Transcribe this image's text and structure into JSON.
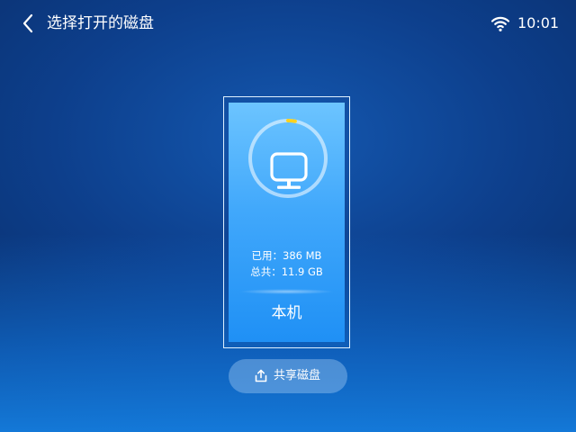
{
  "header": {
    "title": "选择打开的磁盘",
    "back_icon": "chevron-left-icon"
  },
  "status_bar": {
    "wifi_icon": "wifi-icon",
    "time": "10:01"
  },
  "disk": {
    "label": "本机",
    "used_line": "已用：386 MB",
    "total_line": "总共：11.9 GB",
    "usage_fraction": 0.03,
    "icon": "monitor-icon",
    "ring_accent_color": "#ffd21f",
    "selected": true
  },
  "share_button": {
    "label": "共享磁盘",
    "icon": "share-upload-icon"
  },
  "colors": {
    "background_top": "#0a2a63",
    "background_center": "#1458b0",
    "card_top": "#6cc4ff",
    "card_bottom": "#1f90f5"
  }
}
